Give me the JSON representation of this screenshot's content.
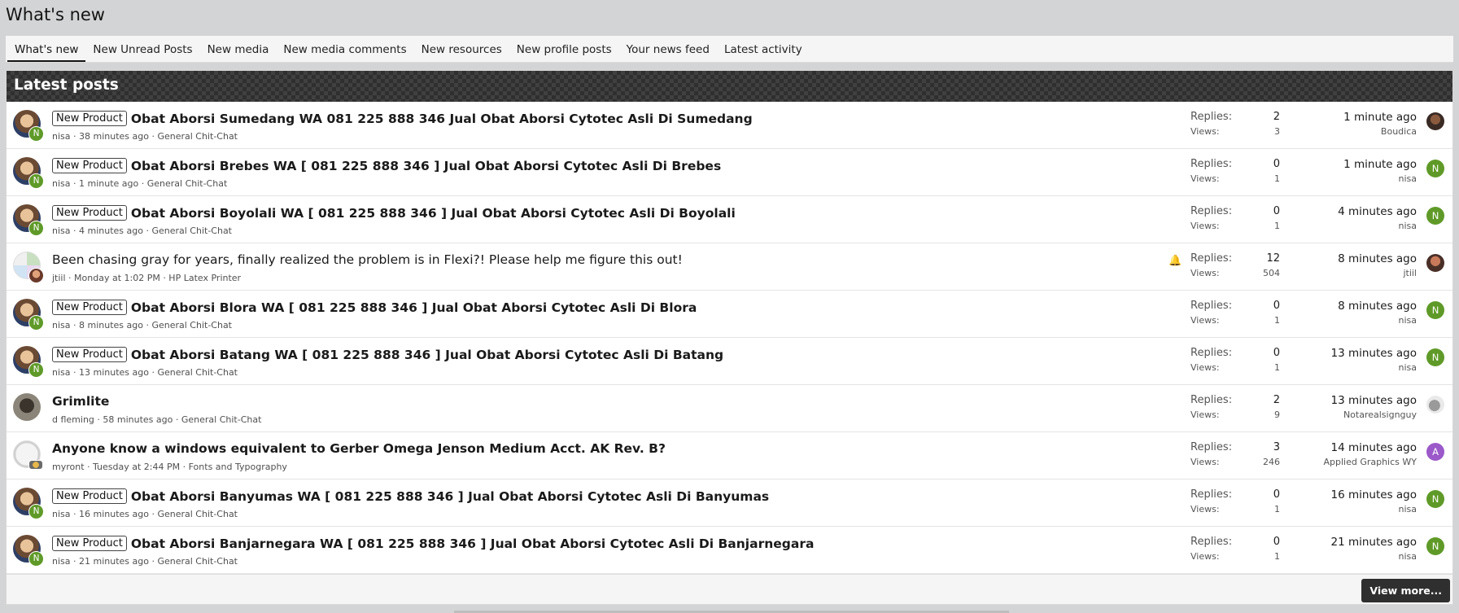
{
  "page": {
    "title": "What's new"
  },
  "tabs": [
    {
      "label": "What's new",
      "active": true
    },
    {
      "label": "New Unread Posts"
    },
    {
      "label": "New media"
    },
    {
      "label": "New media comments"
    },
    {
      "label": "New resources"
    },
    {
      "label": "New profile posts"
    },
    {
      "label": "Your news feed"
    },
    {
      "label": "Latest activity"
    }
  ],
  "block": {
    "header": "Latest posts",
    "view_more_label": "View more..."
  },
  "labels": {
    "replies": "Replies:",
    "views": "Views:"
  },
  "threads": [
    {
      "prefix": "New Product",
      "title": "Obat Aborsi Sumedang WA 081 225 888 346 Jual Obat Aborsi Cytotec Asli Di Sumedang",
      "meta": "nisa · 38 minutes ago · General Chit-Chat",
      "replies": "2",
      "views": "3",
      "latest_time": "1 minute ago",
      "latest_user": "Boudica",
      "avatar_letter": "N",
      "latest_letter": ""
    },
    {
      "prefix": "New Product",
      "title": "Obat Aborsi Brebes WA [ 081 225 888 346 ] Jual Obat Aborsi Cytotec Asli Di Brebes",
      "meta": "nisa · 1 minute ago · General Chit-Chat",
      "replies": "0",
      "views": "1",
      "latest_time": "1 minute ago",
      "latest_user": "nisa",
      "avatar_letter": "N",
      "latest_letter": "N"
    },
    {
      "prefix": "New Product",
      "title": "Obat Aborsi Boyolali WA [ 081 225 888 346 ] Jual Obat Aborsi Cytotec Asli Di Boyolali",
      "meta": "nisa · 4 minutes ago · General Chit-Chat",
      "replies": "0",
      "views": "1",
      "latest_time": "4 minutes ago",
      "latest_user": "nisa",
      "avatar_letter": "N",
      "latest_letter": "N"
    },
    {
      "prefix": "",
      "title": "Been chasing gray for years, finally realized the problem is in Flexi?! Please help me figure this out!",
      "meta": "jtiil · Monday at 1:02 PM · HP Latex Printer",
      "replies": "12",
      "views": "504",
      "latest_time": "8 minutes ago",
      "latest_user": "jtiil",
      "avatar_letter": "",
      "latest_letter": ""
    },
    {
      "prefix": "New Product",
      "title": "Obat Aborsi Blora WA [ 081 225 888 346 ] Jual Obat Aborsi Cytotec Asli Di Blora",
      "meta": "nisa · 8 minutes ago · General Chit-Chat",
      "replies": "0",
      "views": "1",
      "latest_time": "8 minutes ago",
      "latest_user": "nisa",
      "avatar_letter": "N",
      "latest_letter": "N"
    },
    {
      "prefix": "New Product",
      "title": "Obat Aborsi Batang WA [ 081 225 888 346 ] Jual Obat Aborsi Cytotec Asli Di Batang",
      "meta": "nisa · 13 minutes ago · General Chit-Chat",
      "replies": "0",
      "views": "1",
      "latest_time": "13 minutes ago",
      "latest_user": "nisa",
      "avatar_letter": "N",
      "latest_letter": "N"
    },
    {
      "prefix": "",
      "title": "Grimlite",
      "meta": "d fleming · 58 minutes ago · General Chit-Chat",
      "replies": "2",
      "views": "9",
      "latest_time": "13 minutes ago",
      "latest_user": "Notarealsignguy",
      "avatar_letter": "",
      "latest_letter": ""
    },
    {
      "prefix": "",
      "title": "Anyone know a windows equivalent to Gerber Omega Jenson Medium Acct. AK Rev. B?",
      "meta": "myront · Tuesday at 2:44 PM · Fonts and Typography",
      "replies": "3",
      "views": "246",
      "latest_time": "14 minutes ago",
      "latest_user": "Applied Graphics WY",
      "avatar_letter": "",
      "latest_letter": "A"
    },
    {
      "prefix": "New Product",
      "title": "Obat Aborsi Banyumas WA [ 081 225 888 346 ] Jual Obat Aborsi Cytotec Asli Di Banyumas",
      "meta": "nisa · 16 minutes ago · General Chit-Chat",
      "replies": "0",
      "views": "1",
      "latest_time": "16 minutes ago",
      "latest_user": "nisa",
      "avatar_letter": "N",
      "latest_letter": "N"
    },
    {
      "prefix": "New Product",
      "title": "Obat Aborsi Banjarnegara WA [ 081 225 888 346 ] Jual Obat Aborsi Cytotec Asli Di Banjarnegara",
      "meta": "nisa · 21 minutes ago · General Chit-Chat",
      "replies": "0",
      "views": "1",
      "latest_time": "21 minutes ago",
      "latest_user": "nisa",
      "avatar_letter": "N",
      "latest_letter": "N"
    }
  ],
  "colors": {
    "accent": "#141414",
    "badge_green": "#5f9a28",
    "badge_purple": "#9b59c9",
    "header_bg": "#2f2f2f"
  }
}
